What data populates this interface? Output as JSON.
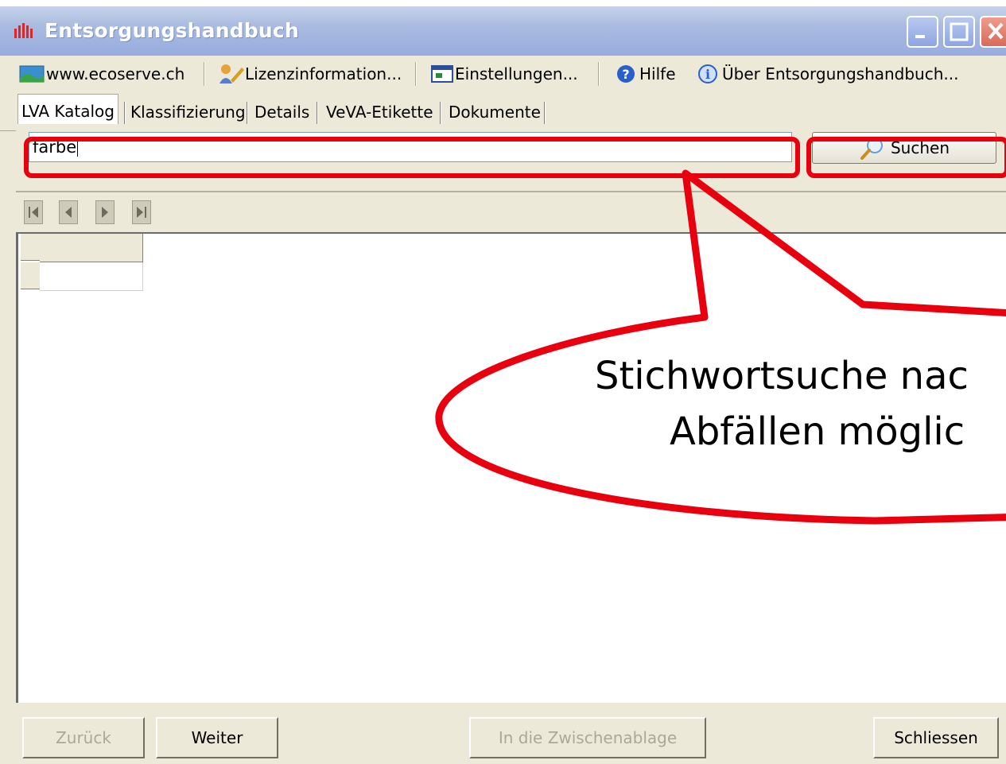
{
  "window": {
    "title": "Entsorgungshandbuch"
  },
  "toolbar": {
    "items": [
      {
        "label": "www.ecoserve.ch",
        "icon": "globe-icon"
      },
      {
        "label": "Lizenzinformation...",
        "icon": "license-icon"
      },
      {
        "label": "Einstellungen...",
        "icon": "settings-icon"
      },
      {
        "label": "Hilfe",
        "icon": "help-icon"
      },
      {
        "label": "Über Entsorgungshandbuch...",
        "icon": "info-icon"
      }
    ]
  },
  "tabs": [
    {
      "label": "LVA Katalog",
      "active": true
    },
    {
      "label": "Klassifizierung",
      "active": false
    },
    {
      "label": "Details",
      "active": false
    },
    {
      "label": "VeVA-Etikette",
      "active": false
    },
    {
      "label": "Dokumente",
      "active": false
    }
  ],
  "search": {
    "value": "farbe",
    "button_label": "Suchen"
  },
  "bottom_buttons": {
    "back": "Zurück",
    "next": "Weiter",
    "clipboard": "In die Zwischenablage",
    "close": "Schliessen"
  },
  "annotation": {
    "line1": "Stichwortsuche nac",
    "line2": "Abfällen möglic",
    "color": "#e8000f"
  }
}
